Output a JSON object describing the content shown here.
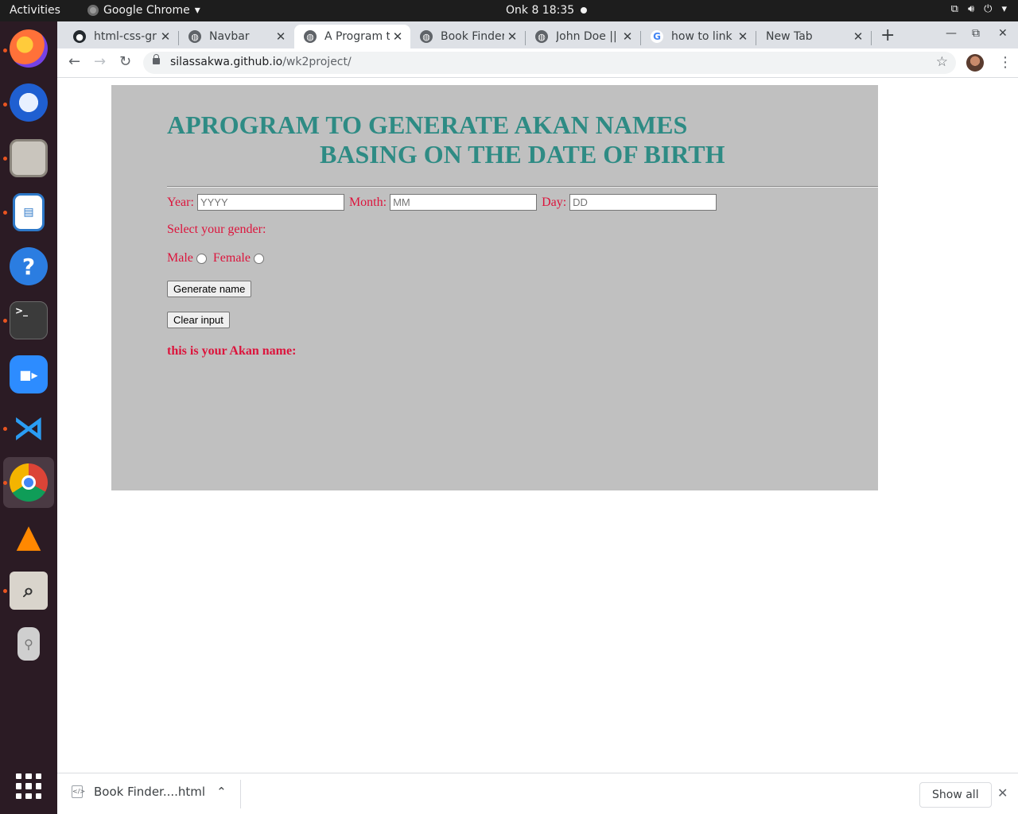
{
  "system_bar": {
    "activities": "Activities",
    "app_name": "Google Chrome",
    "clock": "Onk 8  18:35"
  },
  "dock": {
    "items": [
      "firefox-icon",
      "thunderbird-icon",
      "files-icon",
      "writer-icon",
      "help-icon",
      "terminal-icon",
      "zoom-icon",
      "vscode-icon",
      "chrome-icon",
      "vlc-icon",
      "search-tool-icon",
      "usb-drive-icon"
    ],
    "active": "chrome-icon"
  },
  "tabs": [
    {
      "title": "html-css-gri",
      "icon": "github-icon"
    },
    {
      "title": "Navbar",
      "icon": "globe-icon"
    },
    {
      "title": "A Program t",
      "icon": "globe-icon",
      "active": true
    },
    {
      "title": "Book Finder",
      "icon": "globe-icon"
    },
    {
      "title": "John Doe ||",
      "icon": "globe-icon"
    },
    {
      "title": "how to link",
      "icon": "google-icon"
    },
    {
      "title": "New Tab",
      "icon": ""
    }
  ],
  "address_bar": {
    "host": "silassakwa.github.io",
    "path": "/wk2project/"
  },
  "page": {
    "title_line1": "APROGRAM TO GENERATE AKAN NAMES",
    "title_line2": "BASING ON THE DATE OF BIRTH",
    "year_label": "Year:",
    "year_placeholder": "YYYY",
    "month_label": "Month:",
    "month_placeholder": "MM",
    "day_label": "Day:",
    "day_placeholder": "DD",
    "gender_prompt": "Select your gender:",
    "male_label": "Male",
    "female_label": "Female",
    "generate_button": "Generate name",
    "clear_button": "Clear input",
    "result_label": "this is your Akan name:"
  },
  "download_shelf": {
    "file_name": "Book Finder....html",
    "show_all": "Show all"
  },
  "colors": {
    "heading": "#2e8b84",
    "label": "#dc143c",
    "panel_bg": "#c0c0c0"
  }
}
